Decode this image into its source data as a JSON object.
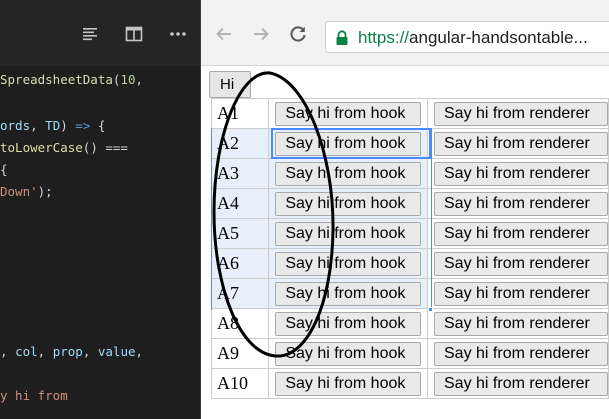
{
  "editor": {
    "toolbar_icons": [
      "outline-icon",
      "split-editor-icon",
      "more-actions-icon"
    ],
    "lines": [
      [
        {
          "t": "SpreadsheetData",
          "c": "c-fn"
        },
        {
          "t": "(",
          "c": "c-plain"
        },
        {
          "t": "10",
          "c": "c-num"
        },
        {
          "t": ",",
          "c": "c-plain"
        }
      ],
      [
        {
          "t": "ords",
          "c": "c-var"
        },
        {
          "t": ", ",
          "c": "c-plain"
        },
        {
          "t": "TD",
          "c": "c-var"
        },
        {
          "t": ") ",
          "c": "c-plain"
        },
        {
          "t": "=>",
          "c": "c-kw"
        },
        {
          "t": " {",
          "c": "c-plain"
        }
      ],
      [
        {
          "t": "toLowerCase",
          "c": "c-fn"
        },
        {
          "t": "() ===",
          "c": "c-plain"
        }
      ],
      [
        {
          "t": "{",
          "c": "c-plain"
        }
      ],
      [
        {
          "t": "Down'",
          "c": "c-str"
        },
        {
          "t": ");",
          "c": "c-plain"
        }
      ],
      [
        {
          "t": ", ",
          "c": "c-plain"
        },
        {
          "t": "col",
          "c": "c-var"
        },
        {
          "t": ", ",
          "c": "c-plain"
        },
        {
          "t": "prop",
          "c": "c-var"
        },
        {
          "t": ", ",
          "c": "c-plain"
        },
        {
          "t": "value",
          "c": "c-var"
        },
        {
          "t": ",",
          "c": "c-plain"
        }
      ],
      [
        {
          "t": "y hi from",
          "c": "c-str"
        }
      ]
    ]
  },
  "browser": {
    "nav": [
      "back-arrow-icon",
      "forward-arrow-icon",
      "reload-icon"
    ],
    "url": {
      "scheme": "https://",
      "rest": "angular-handsontable..."
    },
    "lock_color": "#0b8043"
  },
  "page": {
    "hi_button_label": "Hi",
    "hook_label": "Say hi from hook",
    "renderer_label": "Say hi from renderer",
    "rows": [
      {
        "label": "A1",
        "selected": false
      },
      {
        "label": "A2",
        "selected": true
      },
      {
        "label": "A3",
        "selected": true
      },
      {
        "label": "A4",
        "selected": true
      },
      {
        "label": "A5",
        "selected": true
      },
      {
        "label": "A6",
        "selected": true
      },
      {
        "label": "A7",
        "selected": true
      },
      {
        "label": "A8",
        "selected": false
      },
      {
        "label": "A9",
        "selected": false
      },
      {
        "label": "A10",
        "selected": false
      }
    ],
    "selection_color": "#e6effa",
    "active_border_color": "#4b89ff"
  },
  "annotation": {
    "shape": "hand-drawn ellipse",
    "color": "#000000"
  }
}
